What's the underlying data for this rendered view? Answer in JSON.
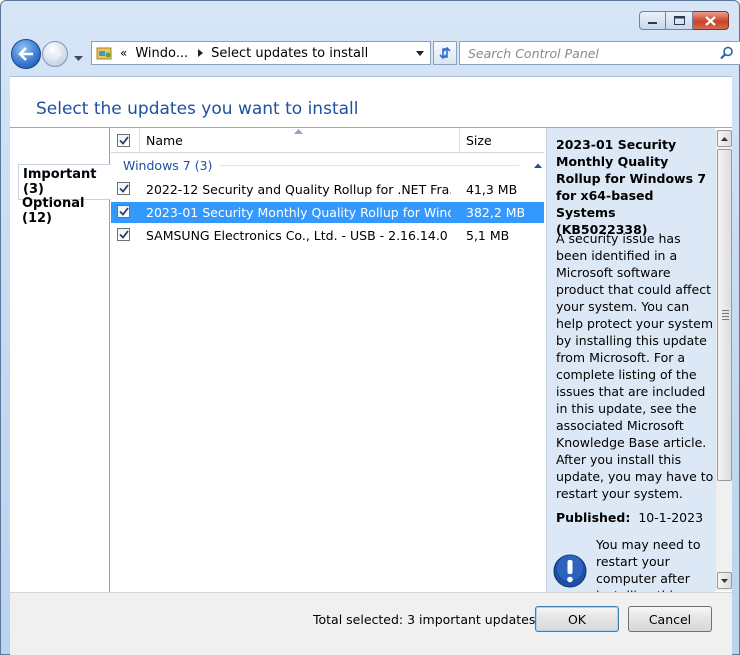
{
  "window": {
    "title": "",
    "caption_buttons": [
      "minimize-icon",
      "maximize-icon",
      "close-icon"
    ]
  },
  "toolbar": {
    "address": {
      "chevron": "«",
      "crumbs": [
        "Windo...",
        "Select updates to install"
      ]
    },
    "search_placeholder": "Search Control Panel"
  },
  "heading": "Select the updates you want to install",
  "categories": [
    {
      "label": "Important (3)",
      "selected": true
    },
    {
      "label": "Optional (12)",
      "selected": false
    }
  ],
  "list": {
    "columns": {
      "name": "Name",
      "size": "Size"
    },
    "group": "Windows 7 (3)",
    "rows": [
      {
        "name": "2022-12 Security and Quality Rollup for .NET Fra...",
        "size": "41,3 MB",
        "checked": true,
        "selected": false
      },
      {
        "name": "2023-01 Security Monthly Quality Rollup for Wind...",
        "size": "382,2 MB",
        "checked": true,
        "selected": true
      },
      {
        "name": "SAMSUNG Electronics Co., Ltd.  - USB - 2.16.14.0",
        "size": "5,1 MB",
        "checked": true,
        "selected": false
      }
    ]
  },
  "details": {
    "title": "2023-01 Security Monthly Quality Rollup for Windows 7 for x64-based Systems (KB5022338)",
    "body": "A security issue has been identified in a Microsoft software product that could affect your system. You can help protect your system by installing this update from Microsoft. For a complete listing of the issues that are included in this update, see the associated Microsoft Knowledge Base article. After you install this update, you may have to restart your system.",
    "published_label": "Published:",
    "published_value": "10-1-2023",
    "restart_note": "You may need to restart your computer after installing this"
  },
  "footer": {
    "total": "Total selected: 3 important updates",
    "ok": "OK",
    "cancel": "Cancel"
  },
  "colors": {
    "accent": "#1e50a2",
    "selection": "#3399ff",
    "details_bg": "#dde8f6"
  }
}
